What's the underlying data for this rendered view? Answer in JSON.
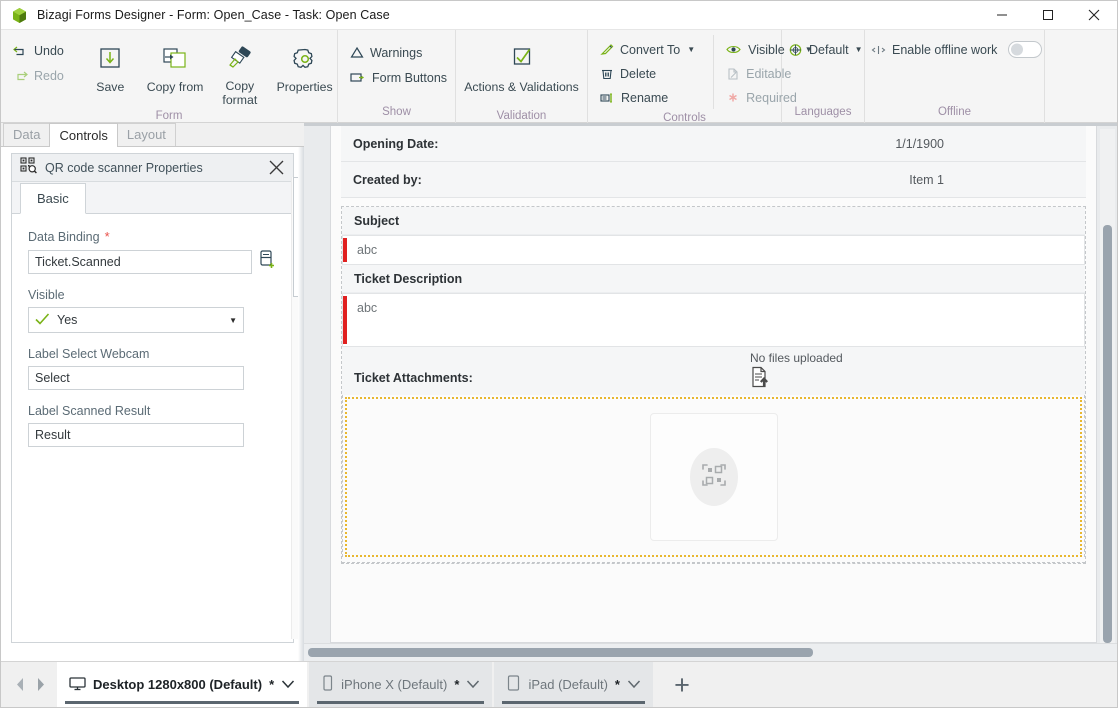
{
  "window": {
    "title": "Bizagi Forms Designer  - Form: Open_Case - Task:  Open Case",
    "minimize_label": "minimize-button",
    "maximize_label": "maximize-button",
    "close_label": "close-button"
  },
  "ribbon": {
    "groups": [
      {
        "name": "form",
        "label": "Form"
      },
      {
        "name": "show",
        "label": "Show"
      },
      {
        "name": "validation",
        "label": "Validation"
      },
      {
        "name": "controls",
        "label": "Controls"
      },
      {
        "name": "languages",
        "label": "Languages"
      },
      {
        "name": "offline",
        "label": "Offline"
      }
    ],
    "undo": "Undo",
    "redo": "Redo",
    "save": "Save",
    "copy_from": "Copy from",
    "copy_format": "Copy format",
    "properties": "Properties",
    "warnings": "Warnings",
    "form_buttons": "Form Buttons",
    "actions_validations": "Actions & Validations",
    "convert_to": "Convert To",
    "delete": "Delete",
    "rename": "Rename",
    "visible": "Visible",
    "editable": "Editable",
    "required": "Required",
    "default_language": "Default",
    "enable_offline_work": "Enable offline work",
    "offline_toggle_state": "off"
  },
  "left_panel": {
    "tabs": [
      {
        "label": "Data",
        "active": false
      },
      {
        "label": "Controls",
        "active": true
      },
      {
        "label": "Layout",
        "active": false
      }
    ],
    "properties_title": "QR code scanner Properties",
    "basic_tab": "Basic",
    "fields": {
      "data_binding_label": "Data Binding",
      "data_binding_required_marker": "*",
      "data_binding_value": "Ticket.Scanned",
      "visible_label": "Visible",
      "visible_value": "Yes",
      "label_select_webcam_label": "Label Select Webcam",
      "label_select_webcam_value": "Select",
      "label_scanned_result_label": "Label Scanned Result",
      "label_scanned_result_value": "Result"
    }
  },
  "form_canvas": {
    "rows": [
      {
        "label": "Opening Date:",
        "value": "1/1/1900"
      },
      {
        "label": "Created by:",
        "value": "Item 1"
      }
    ],
    "subject_label": "Subject",
    "subject_value": "abc",
    "description_label": "Ticket Description",
    "description_value": "abc",
    "attachments_label": "Ticket Attachments:",
    "attachments_status": "No files uploaded",
    "qr_widget_name": "qr-code-scanner-widget"
  },
  "bottom_bar": {
    "prev_label": "previous-device",
    "next_label": "next-device",
    "device_tabs": [
      {
        "label": "Desktop 1280x800 (Default)",
        "modified": "*",
        "active": true,
        "icon": "desktop-icon"
      },
      {
        "label": "iPhone X (Default)",
        "modified": "*",
        "active": false,
        "icon": "phone-icon"
      },
      {
        "label": "iPad (Default)",
        "modified": "*",
        "active": false,
        "icon": "tablet-icon"
      }
    ],
    "add_label": "+"
  },
  "colors": {
    "accent_green": "#7ab317",
    "accent_dark": "#2e4756",
    "required_red": "#e02020",
    "selection_gold": "#e8b730",
    "group_label": "#9e8fa6"
  }
}
